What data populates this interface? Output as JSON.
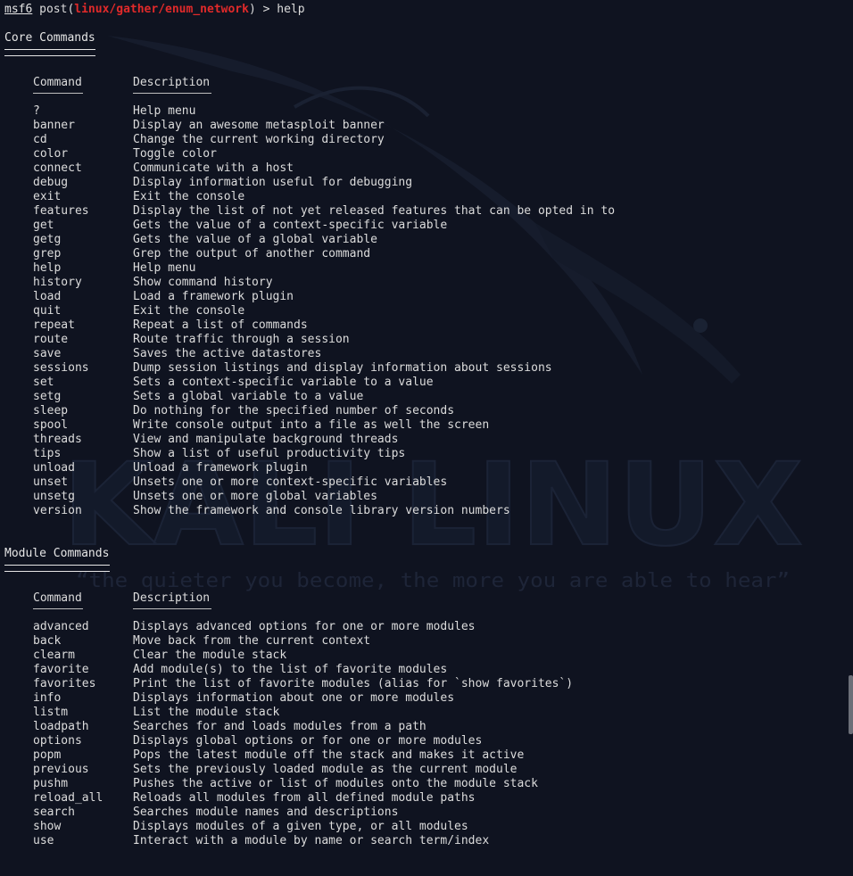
{
  "prompt": {
    "id": "msf6",
    "prefix": " post(",
    "module": "linux/gather/enum_network",
    "suffix": ") > help"
  },
  "core": {
    "title": "Core Commands",
    "header_command": "Command",
    "header_description": "Description",
    "rows": [
      {
        "cmd": "?",
        "desc": "Help menu"
      },
      {
        "cmd": "banner",
        "desc": "Display an awesome metasploit banner"
      },
      {
        "cmd": "cd",
        "desc": "Change the current working directory"
      },
      {
        "cmd": "color",
        "desc": "Toggle color"
      },
      {
        "cmd": "connect",
        "desc": "Communicate with a host"
      },
      {
        "cmd": "debug",
        "desc": "Display information useful for debugging"
      },
      {
        "cmd": "exit",
        "desc": "Exit the console"
      },
      {
        "cmd": "features",
        "desc": "Display the list of not yet released features that can be opted in to"
      },
      {
        "cmd": "get",
        "desc": "Gets the value of a context-specific variable"
      },
      {
        "cmd": "getg",
        "desc": "Gets the value of a global variable"
      },
      {
        "cmd": "grep",
        "desc": "Grep the output of another command"
      },
      {
        "cmd": "help",
        "desc": "Help menu"
      },
      {
        "cmd": "history",
        "desc": "Show command history"
      },
      {
        "cmd": "load",
        "desc": "Load a framework plugin"
      },
      {
        "cmd": "quit",
        "desc": "Exit the console"
      },
      {
        "cmd": "repeat",
        "desc": "Repeat a list of commands"
      },
      {
        "cmd": "route",
        "desc": "Route traffic through a session"
      },
      {
        "cmd": "save",
        "desc": "Saves the active datastores"
      },
      {
        "cmd": "sessions",
        "desc": "Dump session listings and display information about sessions"
      },
      {
        "cmd": "set",
        "desc": "Sets a context-specific variable to a value"
      },
      {
        "cmd": "setg",
        "desc": "Sets a global variable to a value"
      },
      {
        "cmd": "sleep",
        "desc": "Do nothing for the specified number of seconds"
      },
      {
        "cmd": "spool",
        "desc": "Write console output into a file as well the screen"
      },
      {
        "cmd": "threads",
        "desc": "View and manipulate background threads"
      },
      {
        "cmd": "tips",
        "desc": "Show a list of useful productivity tips"
      },
      {
        "cmd": "unload",
        "desc": "Unload a framework plugin"
      },
      {
        "cmd": "unset",
        "desc": "Unsets one or more context-specific variables"
      },
      {
        "cmd": "unsetg",
        "desc": "Unsets one or more global variables"
      },
      {
        "cmd": "version",
        "desc": "Show the framework and console library version numbers"
      }
    ]
  },
  "module": {
    "title": "Module Commands",
    "header_command": "Command",
    "header_description": "Description",
    "rows": [
      {
        "cmd": "advanced",
        "desc": "Displays advanced options for one or more modules"
      },
      {
        "cmd": "back",
        "desc": "Move back from the current context"
      },
      {
        "cmd": "clearm",
        "desc": "Clear the module stack"
      },
      {
        "cmd": "favorite",
        "desc": "Add module(s) to the list of favorite modules"
      },
      {
        "cmd": "favorites",
        "desc": "Print the list of favorite modules (alias for `show favorites`)"
      },
      {
        "cmd": "info",
        "desc": "Displays information about one or more modules"
      },
      {
        "cmd": "listm",
        "desc": "List the module stack"
      },
      {
        "cmd": "loadpath",
        "desc": "Searches for and loads modules from a path"
      },
      {
        "cmd": "options",
        "desc": "Displays global options or for one or more modules"
      },
      {
        "cmd": "popm",
        "desc": "Pops the latest module off the stack and makes it active"
      },
      {
        "cmd": "previous",
        "desc": "Sets the previously loaded module as the current module"
      },
      {
        "cmd": "pushm",
        "desc": "Pushes the active or list of modules onto the module stack"
      },
      {
        "cmd": "reload_all",
        "desc": "Reloads all modules from all defined module paths"
      },
      {
        "cmd": "search",
        "desc": "Searches module names and descriptions"
      },
      {
        "cmd": "show",
        "desc": "Displays modules of a given type, or all modules"
      },
      {
        "cmd": "use",
        "desc": "Interact with a module by name or search term/index"
      }
    ]
  },
  "wallpaper": {
    "logo_text": "KALI LINUX",
    "tagline": "“the quieter you become, the more you are able to hear”"
  },
  "colors": {
    "background": "#0f1320",
    "text": "#dcdcdc",
    "module_red": "#e12a2a"
  }
}
